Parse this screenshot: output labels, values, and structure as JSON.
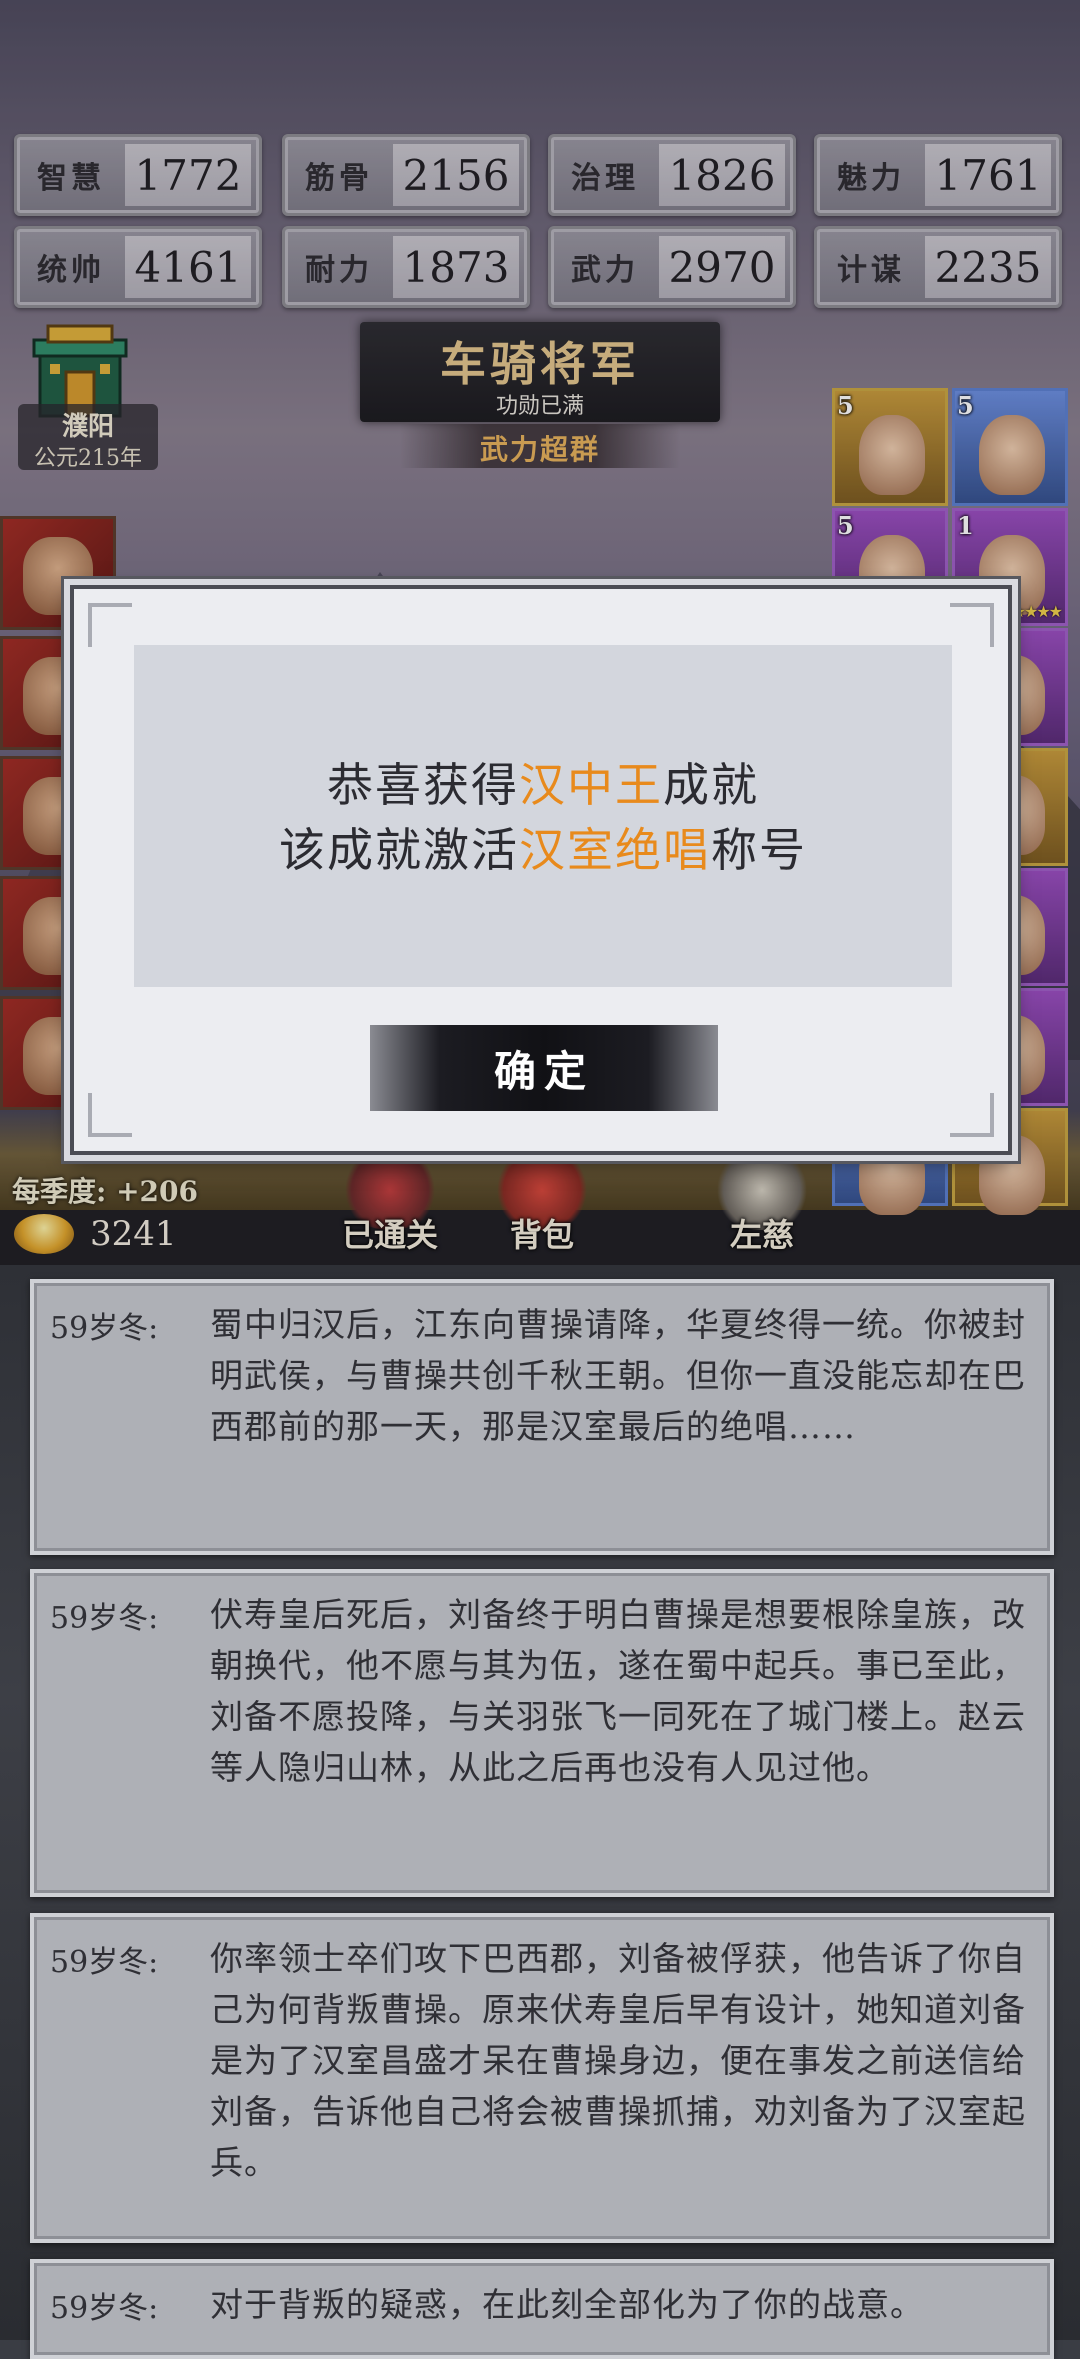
{
  "stats": [
    {
      "label": "智慧",
      "value": "1772"
    },
    {
      "label": "筋骨",
      "value": "2156"
    },
    {
      "label": "治理",
      "value": "1826"
    },
    {
      "label": "魅力",
      "value": "1761"
    },
    {
      "label": "统帅",
      "value": "4161"
    },
    {
      "label": "耐力",
      "value": "1873"
    },
    {
      "label": "武力",
      "value": "2970"
    },
    {
      "label": "计谋",
      "value": "2235"
    }
  ],
  "location": {
    "name": "濮阳",
    "year": "公元215年"
  },
  "title_banner": {
    "title": "车骑将军",
    "sub": "功勋已满",
    "subtitle": "武力超群"
  },
  "right_portraits": [
    {
      "level": "5"
    },
    {
      "level": "5"
    },
    {
      "level": "5"
    },
    {
      "level": "1"
    }
  ],
  "bottom_bar": {
    "season_income": "每季度: +206",
    "gold": "3241",
    "menu": [
      "已通关",
      "背包",
      "左慈"
    ]
  },
  "dialog": {
    "line1_prefix": "恭喜获得",
    "line1_highlight": "汉中王",
    "line1_suffix": "成就",
    "line2_prefix": "该成就激活",
    "line2_highlight": "汉室绝唱",
    "line2_suffix": "称号",
    "confirm": "确定",
    "highlight_color": "#e88a1c"
  },
  "events": [
    {
      "age": "59岁冬:",
      "text": "蜀中归汉后，江东向曹操请降，华夏终得一统。你被封明武侯，与曹操共创千秋王朝。但你一直没能忘却在巴西郡前的那一天，那是汉室最后的绝唱……"
    },
    {
      "age": "59岁冬:",
      "text": "伏寿皇后死后，刘备终于明白曹操是想要根除皇族，改朝换代，他不愿与其为伍，遂在蜀中起兵。事已至此，刘备不愿投降，与关羽张飞一同死在了城门楼上。赵云等人隐归山林，从此之后再也没有人见过他。"
    },
    {
      "age": "59岁冬:",
      "text": "你率领士卒们攻下巴西郡，刘备被俘获，他告诉了你自己为何背叛曹操。原来伏寿皇后早有设计，她知道刘备是为了汉室昌盛才呆在曹操身边，便在事发之前送信给刘备，告诉他自己将会被曹操抓捕，劝刘备为了汉室起兵。"
    },
    {
      "age": "59岁冬:",
      "text": "对于背叛的疑惑，在此刻全部化为了你的战意。"
    }
  ]
}
